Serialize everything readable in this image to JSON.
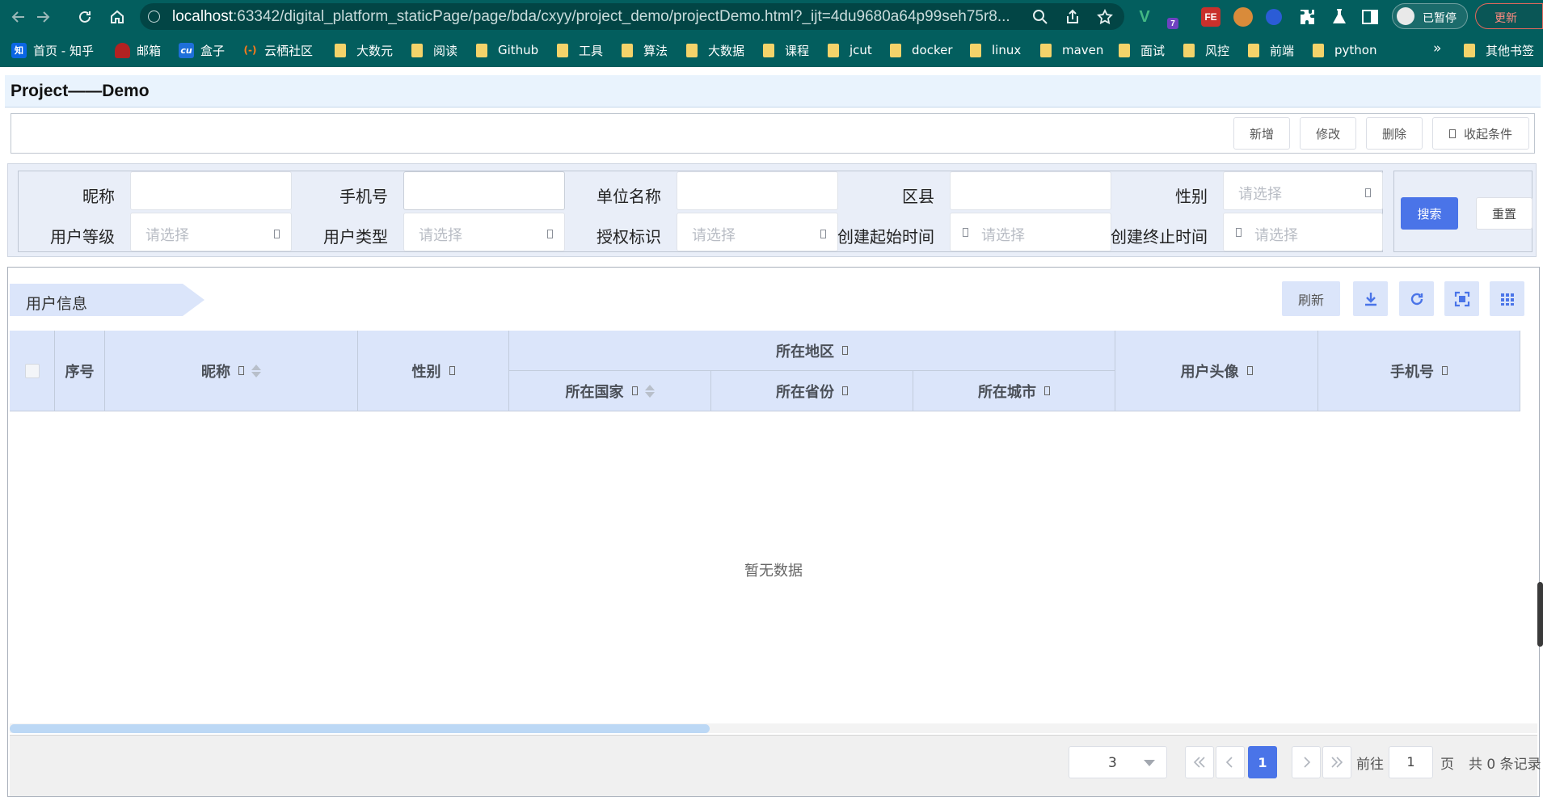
{
  "browser": {
    "url_host": "localhost",
    "url_rest": ":63342/digital_platform_staticPage/page/bda/cxyy/project_demo/projectDemo.html?_ijt=4du9680a64p99seh75r8...",
    "ext_badge": "7",
    "ext_fe": "FE",
    "profile_status": "已暂停",
    "update_label": "更新",
    "bookmarks": [
      {
        "label": "首页 - 知乎",
        "icon": "zhihu-icon",
        "icon_text": "知"
      },
      {
        "label": "邮箱",
        "icon": "mail-icon"
      },
      {
        "label": "盒子",
        "icon": "cu-icon",
        "icon_text": "cu"
      },
      {
        "label": "云栖社区",
        "icon": "aliyun-icon",
        "icon_text": "(-)"
      },
      {
        "label": "大数元",
        "icon": "folder-icon"
      },
      {
        "label": "阅读",
        "icon": "folder-icon"
      },
      {
        "label": "Github",
        "icon": "folder-icon"
      },
      {
        "label": "工具",
        "icon": "folder-icon"
      },
      {
        "label": "算法",
        "icon": "folder-icon"
      },
      {
        "label": "大数据",
        "icon": "folder-icon"
      },
      {
        "label": "课程",
        "icon": "folder-icon"
      },
      {
        "label": "jcut",
        "icon": "folder-icon"
      },
      {
        "label": "docker",
        "icon": "folder-icon"
      },
      {
        "label": "linux",
        "icon": "folder-icon"
      },
      {
        "label": "maven",
        "icon": "folder-icon"
      },
      {
        "label": "面试",
        "icon": "folder-icon"
      },
      {
        "label": "风控",
        "icon": "folder-icon"
      },
      {
        "label": "前端",
        "icon": "folder-icon"
      },
      {
        "label": "python",
        "icon": "folder-icon"
      }
    ],
    "more": "»",
    "other_bookmarks": "其他书签"
  },
  "page": {
    "title": "Project——Demo"
  },
  "toolbar": {
    "add": "新增",
    "edit": "修改",
    "delete": "删除",
    "collapse": "收起条件"
  },
  "search": {
    "fields": {
      "nickname": {
        "label": "昵称",
        "value": ""
      },
      "phone": {
        "label": "手机号",
        "value": ""
      },
      "company": {
        "label": "单位名称",
        "value": ""
      },
      "district": {
        "label": "区县",
        "value": ""
      },
      "gender": {
        "label": "性别",
        "placeholder": "请选择"
      },
      "user_level": {
        "label": "用户等级",
        "placeholder": "请选择"
      },
      "user_type": {
        "label": "用户类型",
        "placeholder": "请选择"
      },
      "auth_flag": {
        "label": "授权标识",
        "placeholder": "请选择"
      },
      "create_start": {
        "label": "创建起始时间",
        "placeholder": "请选择"
      },
      "create_end": {
        "label": "创建终止时间",
        "placeholder": "请选择"
      }
    },
    "search_button": "搜索",
    "reset_button": "重置"
  },
  "table": {
    "title": "用户信息",
    "refresh_button": "刷新",
    "icons": [
      "download-icon",
      "reload-icon",
      "fullscreen-icon",
      "grid-icon"
    ],
    "columns": {
      "index": "序号",
      "nickname": "昵称",
      "gender": "性别",
      "region": "所在地区",
      "country": "所在国家",
      "province": "所在省份",
      "city": "所在城市",
      "avatar": "用户头像",
      "phone": "手机号"
    },
    "rows": [],
    "empty_text": "暂无数据"
  },
  "pagination": {
    "page_size": "3",
    "current_page": "1",
    "goto_label": "前往",
    "goto_value": "1",
    "goto_unit": "页",
    "total_text": "共 0 条记录"
  },
  "colors": {
    "primary": "#4a74e8",
    "header_bg": "#dbe5fa",
    "chrome_bg": "#035e5e"
  }
}
